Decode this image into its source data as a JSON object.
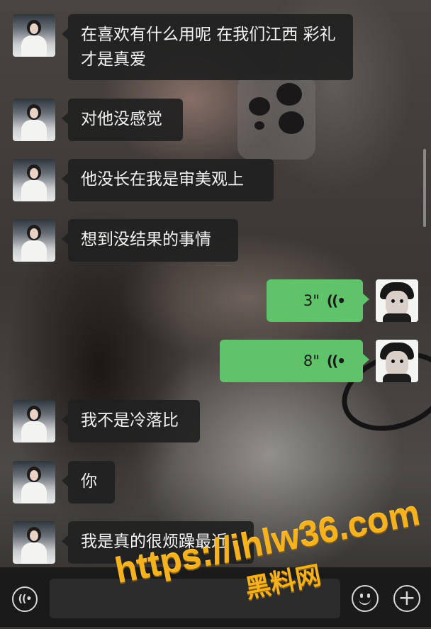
{
  "messages": [
    {
      "side": "in",
      "text": "在喜欢有什么用呢 在我们江西 彩礼才是真爱"
    },
    {
      "side": "in",
      "text": "对他没感觉"
    },
    {
      "side": "in",
      "text": "他没长在我是审美观上"
    },
    {
      "side": "in",
      "text": "想到没结果的事情"
    },
    {
      "side": "out",
      "type": "voice",
      "duration": "3\"",
      "icon": "voice-waves-icon"
    },
    {
      "side": "out",
      "type": "voice",
      "duration": "8\"",
      "icon": "voice-waves-icon"
    },
    {
      "side": "in",
      "text": "我不是冷落比"
    },
    {
      "side": "in",
      "text": "你"
    },
    {
      "side": "in",
      "text": "我是真的很烦躁最近"
    }
  ],
  "voice_glyph": "((•",
  "input_bar": {
    "voice_toggle_glyph": "((•",
    "text_value": "",
    "plus_glyph": "+"
  },
  "watermark": {
    "url": "https://ihlw36.com",
    "name": "黑料网"
  },
  "colors": {
    "incoming_bubble": "#212121",
    "outgoing_bubble": "#5fc369",
    "watermark": "#f6b21c"
  }
}
